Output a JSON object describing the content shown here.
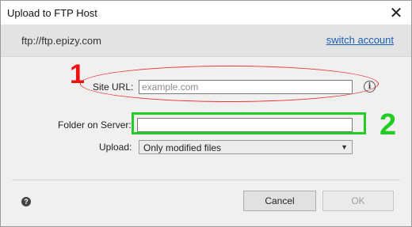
{
  "window": {
    "title": "Upload to FTP Host",
    "close_glyph": "✕"
  },
  "header": {
    "host": "ftp://ftp.epizy.com",
    "switch_account": "switch account"
  },
  "form": {
    "site_url_label": "Site URL:",
    "site_url_placeholder": "example.com",
    "site_url_value": "",
    "folder_label": "Folder on Server:",
    "folder_value": "",
    "upload_label": "Upload:",
    "upload_selected": "Only modified files"
  },
  "annotations": {
    "red_number": "1",
    "green_number": "2",
    "red_color": "#e33333",
    "green_color": "#22cc22"
  },
  "footer": {
    "cancel": "Cancel",
    "ok": "OK",
    "help_icon": "?"
  },
  "icons": {
    "info": "info-icon",
    "help": "help-icon",
    "dropdown": "chevron-down-icon",
    "close": "close-icon"
  }
}
